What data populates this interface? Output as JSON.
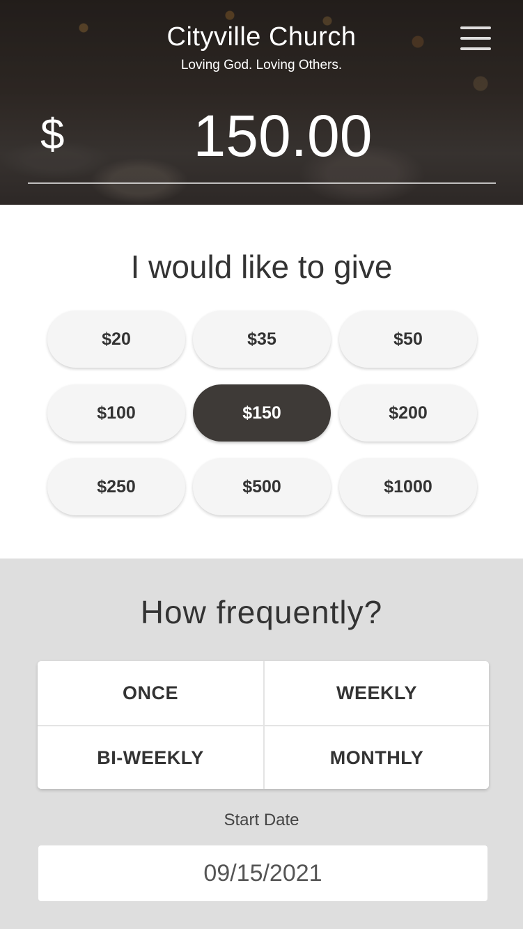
{
  "header": {
    "title": "Cityville Church",
    "tagline": "Loving God. Loving Others.",
    "menu_icon": "hamburger-menu-icon"
  },
  "amount": {
    "currency_symbol": "$",
    "value": "150.00"
  },
  "give": {
    "heading": "I would like to give",
    "presets": [
      "$20",
      "$35",
      "$50",
      "$100",
      "$150",
      "$200",
      "$250",
      "$500",
      "$1000"
    ],
    "selected": "$150"
  },
  "frequency": {
    "heading": "How frequently?",
    "options": [
      "ONCE",
      "WEEKLY",
      "BI-WEEKLY",
      "MONTHLY"
    ]
  },
  "start_date": {
    "label": "Start Date",
    "value": "09/15/2021"
  },
  "colors": {
    "selected_preset": "#3e3a37",
    "section_background": "#dedede"
  }
}
